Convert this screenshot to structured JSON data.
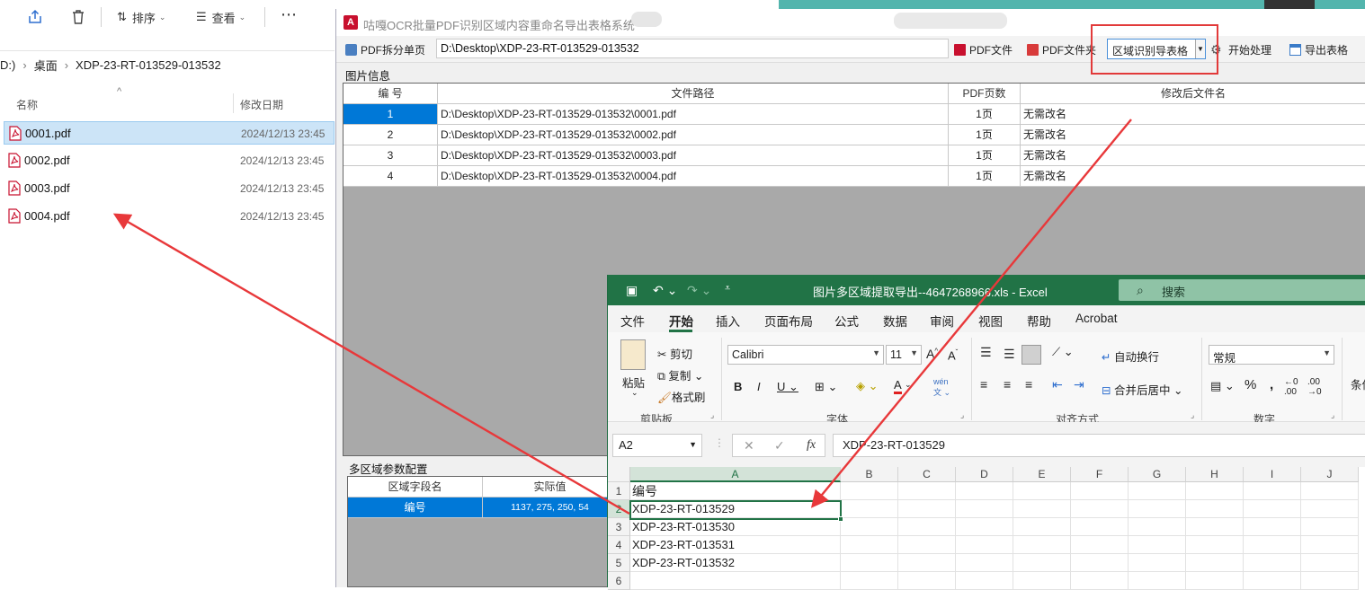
{
  "explorer": {
    "toolbar": {
      "sort_label": "排序",
      "view_label": "查看"
    },
    "breadcrumb": [
      "D:)",
      "桌面",
      "XDP-23-RT-013529-013532"
    ],
    "columns": {
      "name": "名称",
      "modified": "修改日期"
    },
    "files": [
      {
        "name": "0001.pdf",
        "modified": "2024/12/13 23:45",
        "selected": true
      },
      {
        "name": "0002.pdf",
        "modified": "2024/12/13 23:45",
        "selected": false
      },
      {
        "name": "0003.pdf",
        "modified": "2024/12/13 23:45",
        "selected": false
      },
      {
        "name": "0004.pdf",
        "modified": "2024/12/13 23:45",
        "selected": false
      }
    ]
  },
  "ocr_app": {
    "title": "咕嘎OCR批量PDF识别区域内容重命名导出表格系统",
    "toolbar": {
      "split_label": "PDF拆分单页",
      "path_value": "D:\\Desktop\\XDP-23-RT-013529-013532",
      "pdf_file_label": "PDF文件",
      "pdf_folder_label": "PDF文件夹",
      "mode_value": "区域识别导表格",
      "start_label": "开始处理",
      "export_label": "导出表格"
    },
    "image_section_label": "图片信息",
    "table": {
      "headers": [
        "编 号",
        "文件路径",
        "PDF页数",
        "修改后文件名"
      ],
      "rows": [
        [
          "1",
          "D:\\Desktop\\XDP-23-RT-013529-013532\\0001.pdf",
          "1页",
          "无需改名"
        ],
        [
          "2",
          "D:\\Desktop\\XDP-23-RT-013529-013532\\0002.pdf",
          "1页",
          "无需改名"
        ],
        [
          "3",
          "D:\\Desktop\\XDP-23-RT-013529-013532\\0003.pdf",
          "1页",
          "无需改名"
        ],
        [
          "4",
          "D:\\Desktop\\XDP-23-RT-013529-013532\\0004.pdf",
          "1页",
          "无需改名"
        ]
      ]
    },
    "region_section_label": "多区域参数配置",
    "region_table": {
      "headers": [
        "区域字段名",
        "实际值"
      ],
      "rows": [
        [
          "编号",
          "1137, 275, 250, 54"
        ]
      ]
    }
  },
  "excel": {
    "title": "图片多区域提取导出--4647268966.xls  -  Excel",
    "search_placeholder": "搜索",
    "tabs": [
      "文件",
      "开始",
      "插入",
      "页面布局",
      "公式",
      "数据",
      "审阅",
      "视图",
      "帮助",
      "Acrobat"
    ],
    "active_tab": "开始",
    "ribbon": {
      "paste": "粘贴",
      "cut": "剪切",
      "copy": "复制",
      "format_painter": "格式刷",
      "clipboard_group": "剪贴板",
      "font_name": "Calibri",
      "font_size": "11",
      "font_group": "字体",
      "wrap_text": "自动换行",
      "merge_center": "合并后居中",
      "align_group": "对齐方式",
      "number_format": "常规",
      "number_group": "数字",
      "conditional": "条件"
    },
    "name_box": "A2",
    "formula_value": "XDP-23-RT-013529",
    "columns": [
      "A",
      "B",
      "C",
      "D",
      "E",
      "F",
      "G",
      "H",
      "I",
      "J"
    ],
    "rows": [
      "1",
      "2",
      "3",
      "4",
      "5",
      "6"
    ],
    "cells_a": [
      "编号",
      "XDP-23-RT-013529",
      "XDP-23-RT-013530",
      "XDP-23-RT-013531",
      "XDP-23-RT-013532",
      ""
    ]
  },
  "colors": {
    "excel_green": "#217346",
    "selection_blue": "#0078d7",
    "arrow_red": "#e8383a"
  }
}
